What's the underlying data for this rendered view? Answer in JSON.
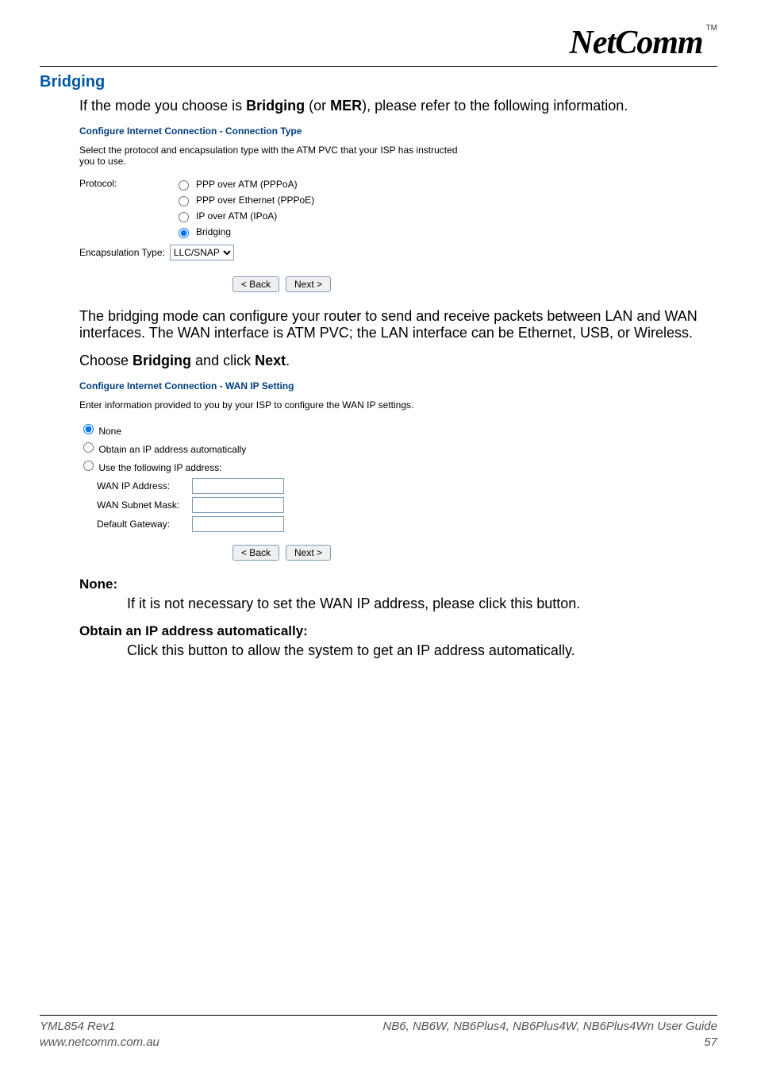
{
  "logo": {
    "text": "NetComm",
    "tm": "TM"
  },
  "sectionHeading": "Bridging",
  "intro": {
    "prefix": "If the mode you choose is ",
    "strong1": "Bridging",
    "mid": " (or ",
    "strong2": "MER",
    "suffix": "), please refer to the following information."
  },
  "shot1": {
    "title": "Configure Internet Connection - Connection Type",
    "desc": "Select the protocol and encapsulation type with the ATM PVC that your ISP has instructed you to use.",
    "protocolLabel": "Protocol:",
    "options": {
      "pppoa": "PPP over ATM (PPPoA)",
      "pppoe": "PPP over Ethernet (PPPoE)",
      "ipoa": "IP over ATM (IPoA)",
      "bridging": "Bridging"
    },
    "encapLabel": "Encapsulation Type:",
    "encapValue": "LLC/SNAP",
    "backLabel": "< Back",
    "nextLabel": "Next >"
  },
  "bridgeDesc": "The bridging mode can configure your router to send and receive packets between LAN and WAN interfaces. The WAN interface is ATM PVC; the LAN interface can be Ethernet, USB, or Wireless.",
  "chooseLine": {
    "prefix": "Choose ",
    "strong1": "Bridging",
    "mid": " and click ",
    "strong2": "Next",
    "suffix": "."
  },
  "shot2": {
    "title": "Configure Internet Connection - WAN IP Setting",
    "desc": "Enter information provided to you by your ISP to configure the WAN IP settings.",
    "options": {
      "none": "None",
      "obtain": "Obtain an IP address automatically",
      "usefollowing": "Use the following IP address:"
    },
    "fields": {
      "wanip": "WAN IP Address:",
      "subnet": "WAN Subnet Mask:",
      "gateway": "Default Gateway:"
    },
    "backLabel": "< Back",
    "nextLabel": "Next >"
  },
  "defs": {
    "noneHead": "None:",
    "noneBody": "If it is not necessary to set the WAN IP address, please click this button.",
    "obtainHead": "Obtain an IP address automatically:",
    "obtainBody": "Click this button to allow the system to get an IP address automatically."
  },
  "footer": {
    "rev": "YML854 Rev1",
    "url": "www.netcomm.com.au",
    "products": "NB6, NB6W, NB6Plus4, NB6Plus4W, NB6Plus4Wn",
    "guide": " User Guide",
    "page": "57"
  }
}
